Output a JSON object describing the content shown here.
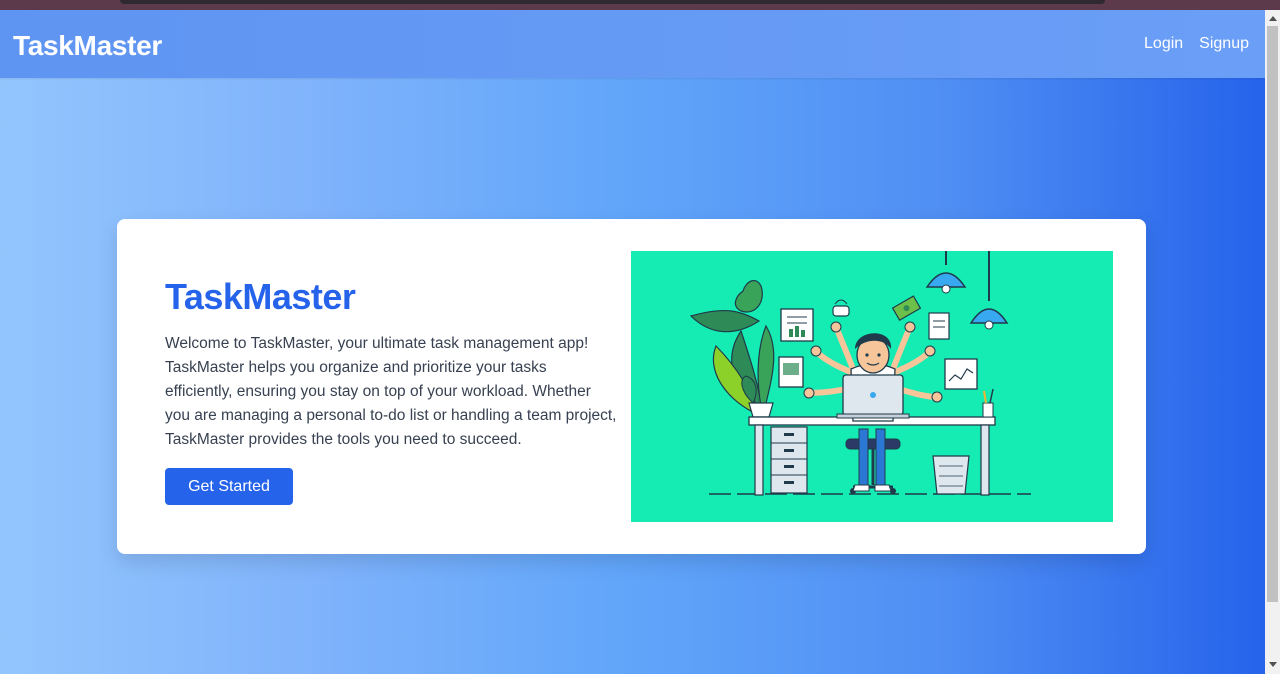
{
  "navbar": {
    "brand": "TaskMaster",
    "links": [
      "Login",
      "Signup"
    ]
  },
  "hero": {
    "title": "TaskMaster",
    "description": "Welcome to TaskMaster, your ultimate task management app! TaskMaster helps you organize and prioritize your tasks efficiently, ensuring you stay on top of your workload. Whether you are managing a personal to-do list or handling a team project, TaskMaster provides the tools you need to succeed.",
    "cta_label": "Get Started",
    "illustration_icon": "multitasking-person-illustration"
  },
  "colors": {
    "accent": "#2563eb",
    "illustration_bg": "#14ecb4",
    "gradient_start": "#93c5fd",
    "gradient_end": "#2563eb"
  }
}
